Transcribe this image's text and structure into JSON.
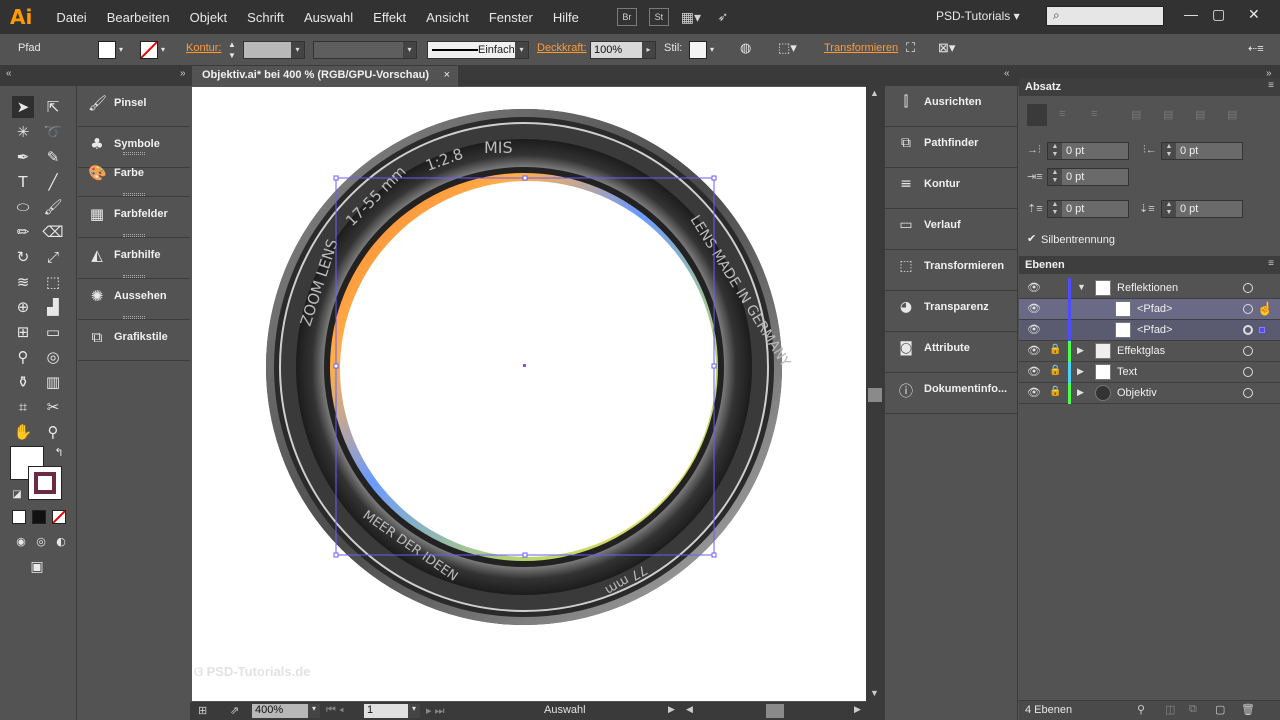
{
  "app": {
    "logo": "Ai",
    "workspace": "PSD-Tutorials",
    "bridge_btn": "Br",
    "stock_btn": "St"
  },
  "menu": [
    "Datei",
    "Bearbeiten",
    "Objekt",
    "Schrift",
    "Auswahl",
    "Effekt",
    "Ansicht",
    "Fenster",
    "Hilfe"
  ],
  "control": {
    "selection_type": "Pfad",
    "stroke_label": "Kontur:",
    "stroke_style": "Einfach",
    "opacity_label": "Deckkraft:",
    "opacity_value": "100%",
    "style_label": "Stil:",
    "transform_link": "Transformieren"
  },
  "document": {
    "tab_title": "Objektiv.ai* bei 400 % (RGB/GPU-Vorschau)",
    "close": "×"
  },
  "left_panels": [
    {
      "label": "Pinsel",
      "icon": "brush-icon"
    },
    {
      "label": "Symbole",
      "icon": "symbol-icon"
    },
    {
      "label": "Farbe",
      "icon": "palette-icon"
    },
    {
      "label": "Farbfelder",
      "icon": "swatches-icon"
    },
    {
      "label": "Farbhilfe",
      "icon": "color-guide-icon"
    },
    {
      "label": "Aussehen",
      "icon": "appearance-icon"
    },
    {
      "label": "Grafikstile",
      "icon": "graphic-styles-icon"
    }
  ],
  "mid_panels": [
    {
      "label": "Ausrichten",
      "icon": "align-icon"
    },
    {
      "label": "Pathfinder",
      "icon": "pathfinder-icon"
    },
    {
      "label": "Kontur",
      "icon": "stroke-icon"
    },
    {
      "label": "Verlauf",
      "icon": "gradient-icon"
    },
    {
      "label": "Transformieren",
      "icon": "transform-icon"
    },
    {
      "label": "Transparenz",
      "icon": "transparency-icon"
    },
    {
      "label": "Attribute",
      "icon": "attributes-icon"
    },
    {
      "label": "Dokumentinfo...",
      "icon": "doc-info-icon"
    }
  ],
  "paragraph": {
    "title": "Absatz",
    "left_indent": "0 pt",
    "right_indent": "0 pt",
    "first_line_indent": "0 pt",
    "space_before": "0 pt",
    "space_after": "0 pt",
    "hyphenation_label": "Silbentrennung"
  },
  "layers": {
    "title": "Ebenen",
    "rows": [
      {
        "name": "Reflektionen",
        "indent": 0,
        "expanded": true,
        "locked": false,
        "color": "#4d4dff"
      },
      {
        "name": "<Pfad>",
        "indent": 1,
        "locked": false,
        "color": "#4d4dff"
      },
      {
        "name": "<Pfad>",
        "indent": 1,
        "locked": false,
        "color": "#4d4dff"
      },
      {
        "name": "Effektglas",
        "indent": 0,
        "locked": true,
        "color": "#4dff4d"
      },
      {
        "name": "Text",
        "indent": 0,
        "locked": true,
        "color": "#4dd2ff"
      },
      {
        "name": "Objektiv",
        "indent": 0,
        "locked": true,
        "color": "#4dff4d"
      }
    ],
    "count": "4 Ebenen"
  },
  "lens": {
    "text_top": "MIS",
    "text_aperture": "1:2.8",
    "text_focal": "17-55 mm",
    "text_zoom": "ZOOM LENS",
    "text_made": "LENS MADE IN GERMANY",
    "text_bottom": "MEER DER IDEEN",
    "text_filter": "77 mm"
  },
  "status": {
    "zoom": "400%",
    "artboard": "1",
    "tool": "Auswahl"
  },
  "watermark": "PSD-Tutorials.de"
}
